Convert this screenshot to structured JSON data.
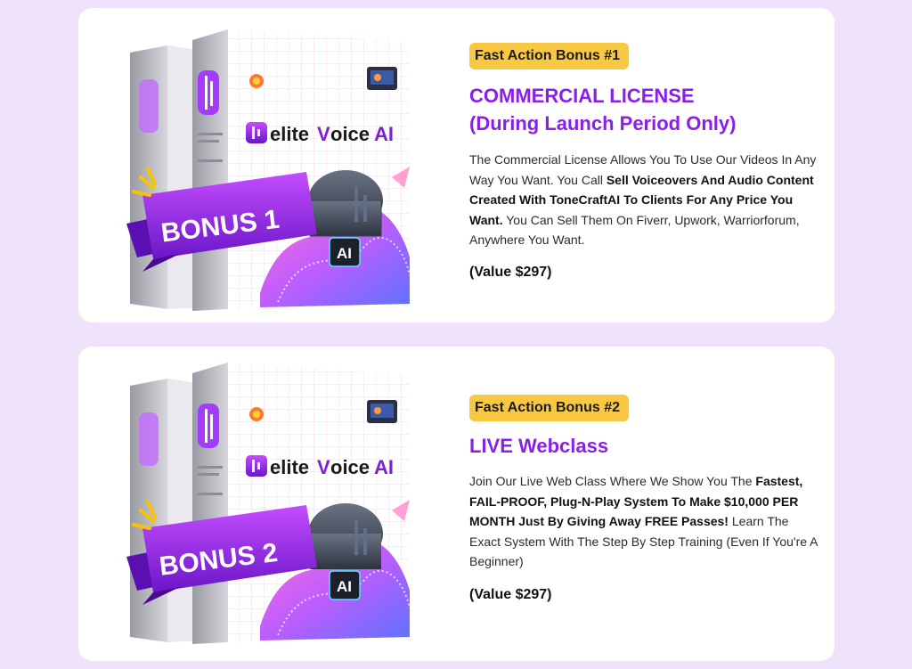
{
  "bonuses": [
    {
      "badge": "Fast Action Bonus #1",
      "title_line1": "COMMERCIAL LICENSE",
      "title_line2": "(During Launch Period Only)",
      "desc": [
        {
          "t": "The Commercial License Allows You To Use Our Videos In Any Way You Want. You Call ",
          "b": false
        },
        {
          "t": "Sell Voiceovers And Audio Content Created With ToneCraftAI To Clients For Any Price You Want.",
          "b": true
        },
        {
          "t": " You Can Sell Them On Fiverr, Upwork, Warriorforum, Anywhere You Want.",
          "b": false
        }
      ],
      "value": "(Value $297)",
      "ribbon": "BONUS 1",
      "logo_left": "elite",
      "logo_mid": "oice",
      "logo_ai": "AI",
      "chip": "AI"
    },
    {
      "badge": "Fast Action Bonus #2",
      "title_line1": "LIVE Webclass",
      "title_line2": "",
      "desc": [
        {
          "t": "Join Our Live Web Class Where We Show You The ",
          "b": false
        },
        {
          "t": "Fastest, FAIL-PROOF, Plug-N-Play System To Make $10,000 PER MONTH Just By Giving Away FREE Passes!",
          "b": true
        },
        {
          "t": " Learn The Exact System With The Step By Step Training (Even If You're A Beginner)",
          "b": false
        }
      ],
      "value": "(Value $297)",
      "ribbon": "BONUS 2",
      "logo_left": "elite",
      "logo_mid": "oice",
      "logo_ai": "AI",
      "chip": "AI"
    }
  ],
  "colors": {
    "page_bg": "#efe2fb",
    "card_bg": "#ffffff",
    "accent_purple": "#8a1fe8",
    "badge_yellow": "#f9c843",
    "ribbon_purple": "#7b1fd8"
  }
}
